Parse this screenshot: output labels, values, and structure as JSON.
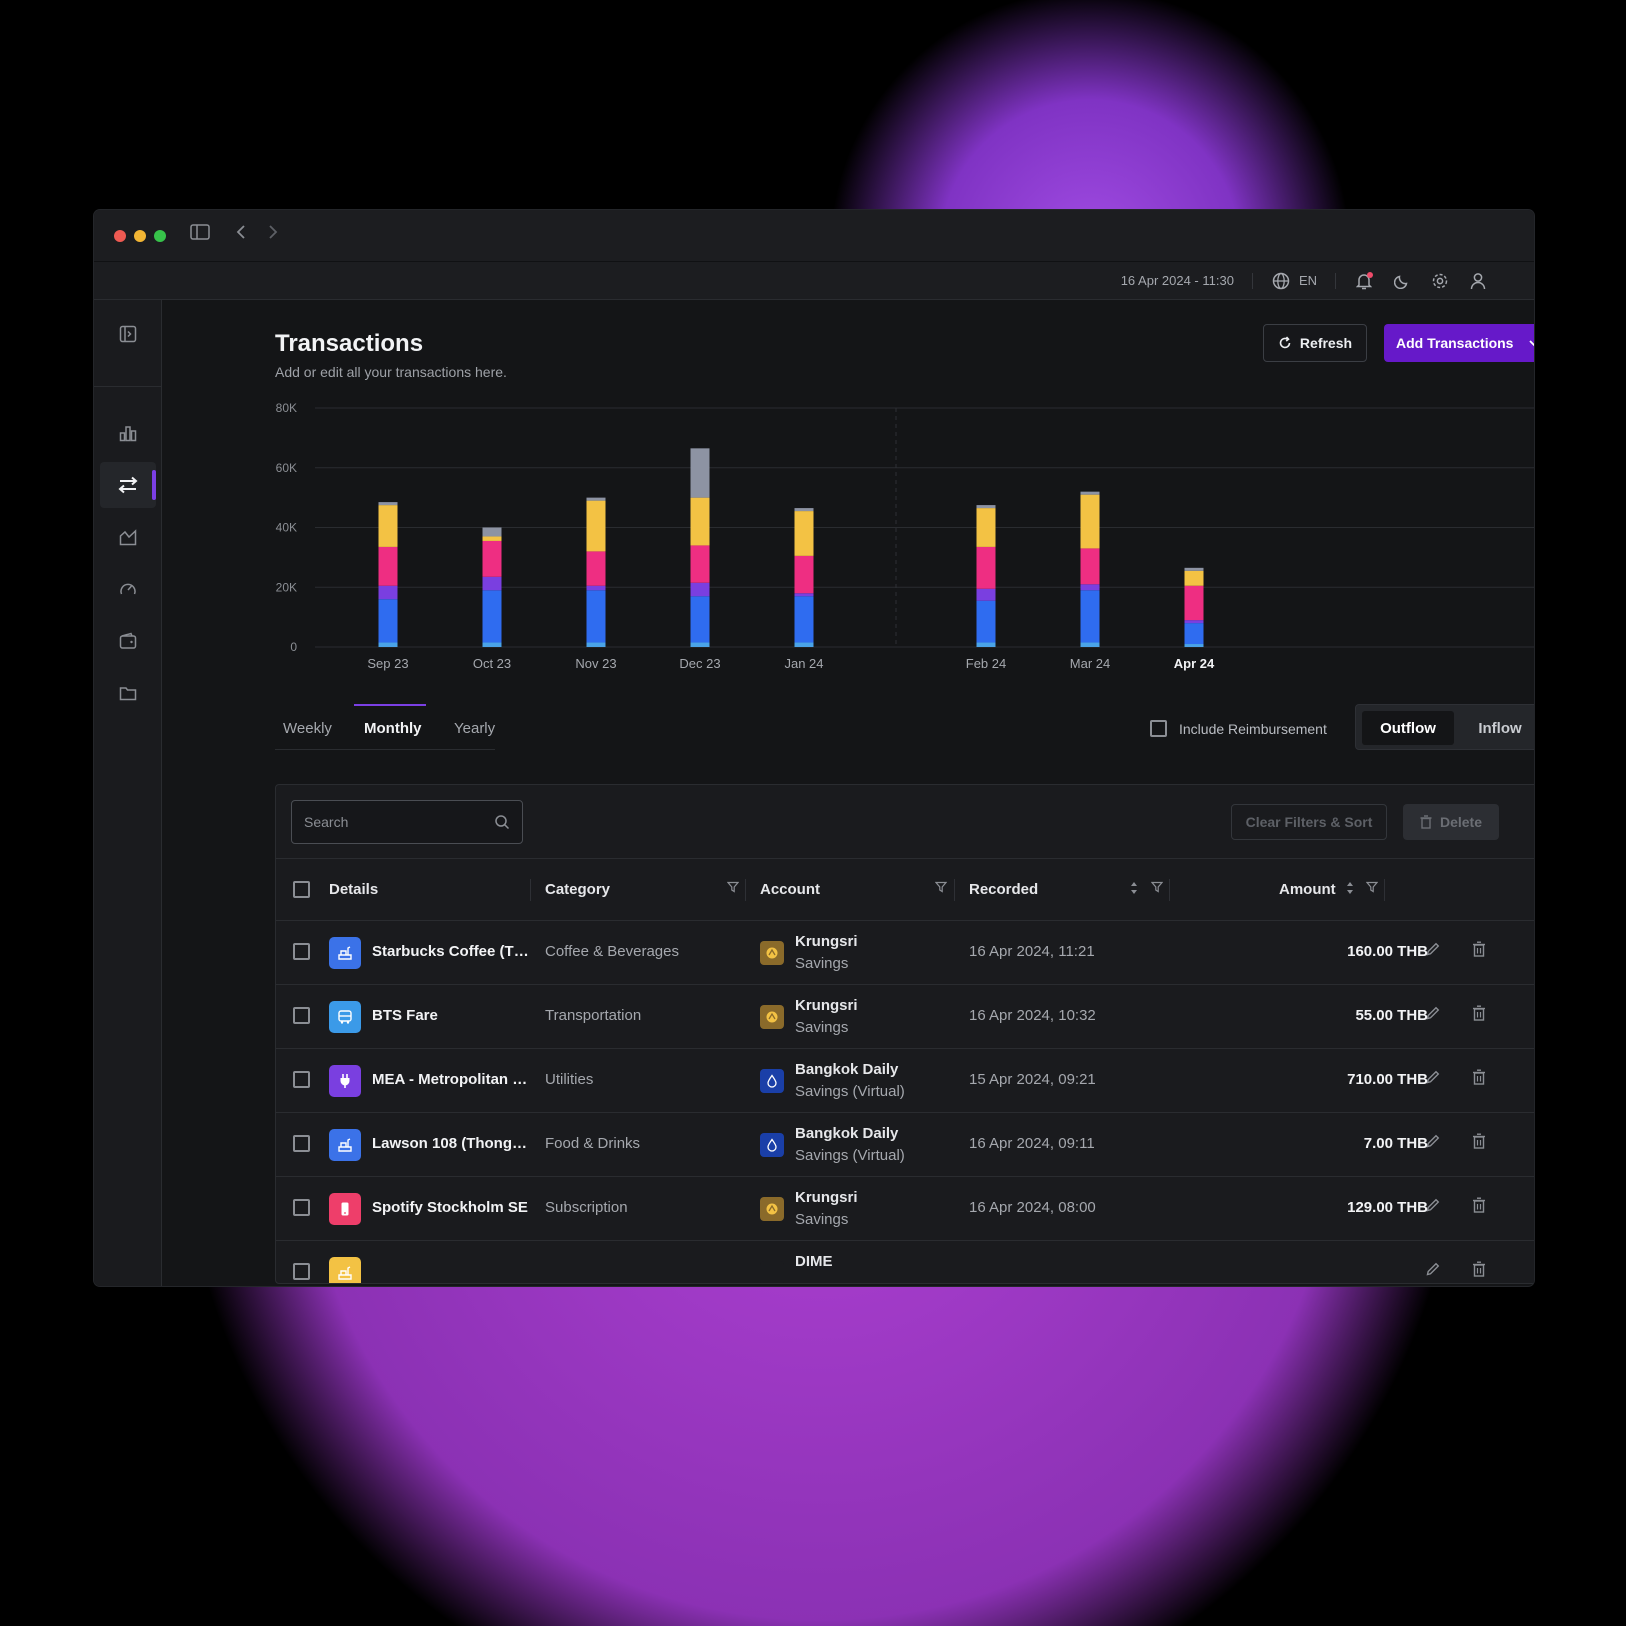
{
  "window": {
    "controls": [
      "close",
      "minimize",
      "maximize"
    ],
    "toolbar_icons": [
      "sidebar-toggle-icon",
      "back-icon",
      "forward-icon"
    ]
  },
  "topbar": {
    "datetime": "16 Apr 2024 - 11:30",
    "language": "EN",
    "icons": [
      "globe-icon",
      "bell-icon",
      "moon-icon",
      "gear-icon",
      "user-icon"
    ]
  },
  "sidebar": {
    "items": [
      {
        "name": "collapse",
        "icon": "sidebar-collapse-icon",
        "active": false
      },
      {
        "name": "dashboard",
        "icon": "bar-chart-icon",
        "active": false
      },
      {
        "name": "transactions",
        "icon": "swap-arrows-icon",
        "active": true
      },
      {
        "name": "reports",
        "icon": "area-chart-icon",
        "active": false
      },
      {
        "name": "budget",
        "icon": "gauge-icon",
        "active": false
      },
      {
        "name": "accounts",
        "icon": "wallet-icon",
        "active": false
      },
      {
        "name": "files",
        "icon": "folder-icon",
        "active": false
      }
    ]
  },
  "header": {
    "title": "Transactions",
    "subtitle": "Add or edit all your transactions here.",
    "refresh_label": "Refresh",
    "add_label": "Add Transactions"
  },
  "chart_data": {
    "type": "bar",
    "stacked": true,
    "categories": [
      "Sep 23",
      "Oct 23",
      "Nov 23",
      "Dec 23",
      "Jan 24",
      "Feb 24",
      "Mar 24",
      "Apr 24"
    ],
    "highlighted_category": "Apr 24",
    "yticks": [
      "0",
      "20K",
      "40K",
      "60K",
      "80K"
    ],
    "ylim": [
      0,
      80000
    ],
    "grid": true,
    "series": [
      {
        "color": "#4aa3e8",
        "values": [
          1500,
          1500,
          1500,
          1500,
          1500,
          1500,
          1500,
          1000
        ]
      },
      {
        "color": "#2f6cf0",
        "values": [
          14500,
          17500,
          17500,
          15500,
          15500,
          14000,
          17500,
          7000
        ]
      },
      {
        "color": "#7a3fe0",
        "values": [
          4500,
          4500,
          1500,
          4500,
          1000,
          4000,
          2000,
          1000
        ]
      },
      {
        "color": "#ee2e82",
        "values": [
          13000,
          12000,
          11500,
          12500,
          12500,
          14000,
          12000,
          11500
        ]
      },
      {
        "color": "#f3c244",
        "values": [
          14000,
          1500,
          17000,
          16000,
          15000,
          13000,
          18000,
          5000
        ]
      },
      {
        "color": "#8d93a3",
        "values": [
          1000,
          3000,
          1000,
          16500,
          1000,
          1000,
          1000,
          1000
        ]
      }
    ]
  },
  "controls": {
    "tabs": [
      "Weekly",
      "Monthly",
      "Yearly"
    ],
    "active_tab": "Monthly",
    "reimbursement_label": "Include Reimbursement",
    "outflow_label": "Outflow",
    "inflow_label": "Inflow",
    "active_flow": "Outflow"
  },
  "table": {
    "search_placeholder": "Search",
    "clear_label": "Clear Filters & Sort",
    "delete_label": "Delete",
    "columns": {
      "details": "Details",
      "category": "Category",
      "account": "Account",
      "recorded": "Recorded",
      "amount": "Amount"
    },
    "rows": [
      {
        "name": "Starbucks Coffee (Th...",
        "icon": "food-icon",
        "icon_color": "#3b72e8",
        "category": "Coffee & Beverages",
        "bank": "Krungsri",
        "account_type": "Savings",
        "bank_color": "#8a6a2a",
        "recorded": "16 Apr 2024, 11:21",
        "amount": "160.00 THB"
      },
      {
        "name": "BTS Fare",
        "icon": "bus-icon",
        "icon_color": "#3b9ae8",
        "category": "Transportation",
        "bank": "Krungsri",
        "account_type": "Savings",
        "bank_color": "#8a6a2a",
        "recorded": "16 Apr 2024, 10:32",
        "amount": "55.00 THB"
      },
      {
        "name": "MEA - Metropolitan E...",
        "icon": "plug-icon",
        "icon_color": "#7a3fe0",
        "category": "Utilities",
        "bank": "Bangkok Daily",
        "account_type": "Savings (Virtual)",
        "bank_color": "#1a3fa8",
        "recorded": "15 Apr 2024, 09:21",
        "amount": "710.00 THB"
      },
      {
        "name": "Lawson 108 (Thonglo...",
        "icon": "food-icon",
        "icon_color": "#3b72e8",
        "category": "Food & Drinks",
        "bank": "Bangkok Daily",
        "account_type": "Savings (Virtual)",
        "bank_color": "#1a3fa8",
        "recorded": "16 Apr 2024, 09:11",
        "amount": "7.00 THB"
      },
      {
        "name": "Spotify Stockholm SE",
        "icon": "phone-icon",
        "icon_color": "#ee3e6a",
        "category": "Subscription",
        "bank": "Krungsri",
        "account_type": "Savings",
        "bank_color": "#8a6a2a",
        "recorded": "16 Apr 2024, 08:00",
        "amount": "129.00 THB"
      },
      {
        "name": "",
        "icon": "food-icon",
        "icon_color": "#f3c244",
        "category": "",
        "bank": "DIME",
        "account_type": "",
        "bank_color": "#1a1b1e",
        "recorded": "",
        "amount": ""
      }
    ]
  }
}
